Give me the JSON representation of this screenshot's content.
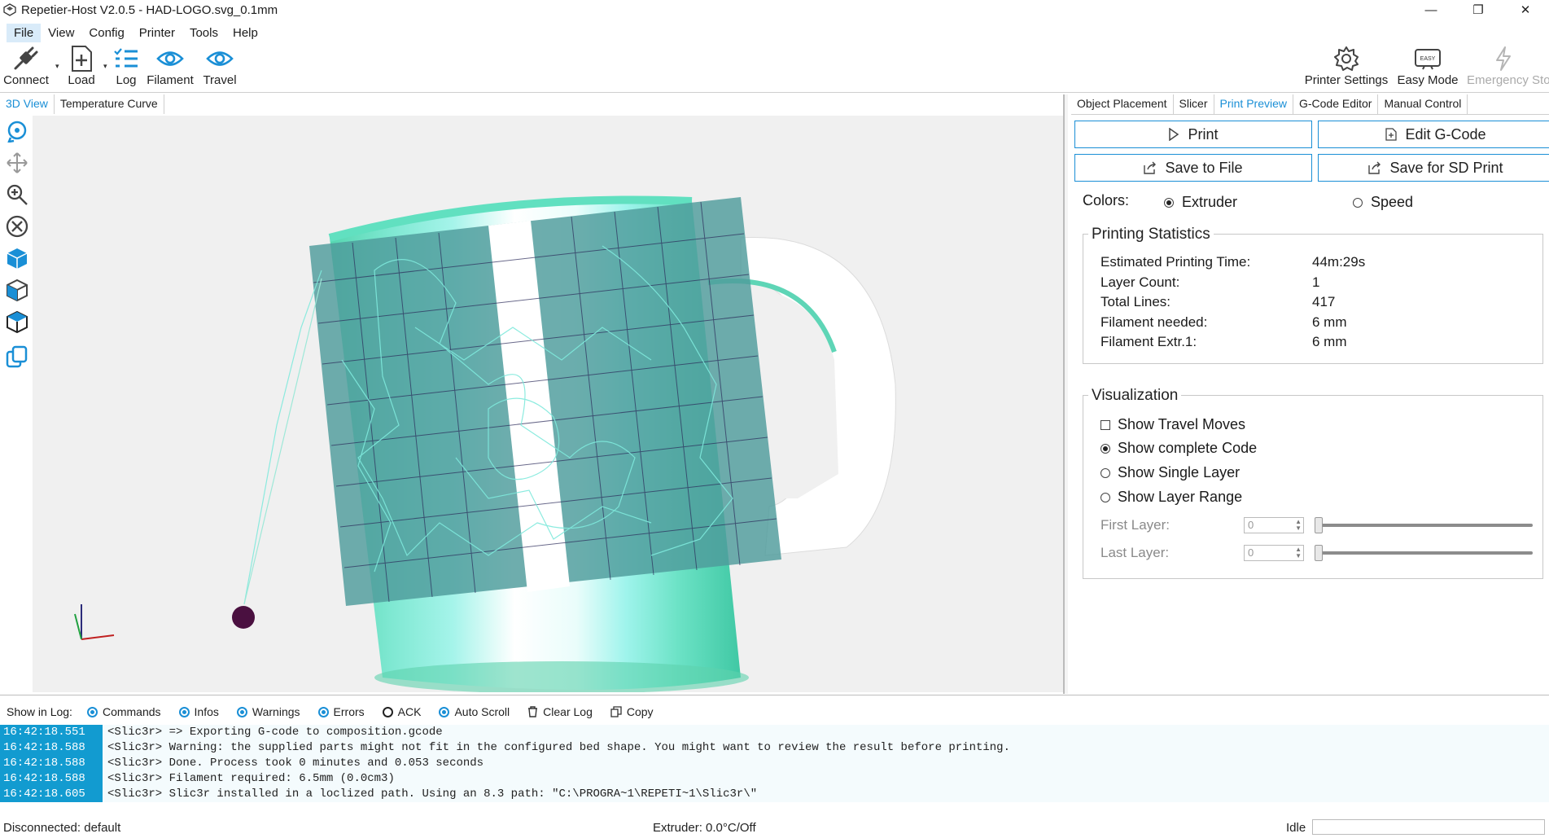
{
  "window": {
    "title": "Repetier-Host V2.0.5 - HAD-LOGO.svg_0.1mm",
    "minimize": "—",
    "maximize": "❐",
    "close": "✕"
  },
  "menu": [
    "File",
    "View",
    "Config",
    "Printer",
    "Tools",
    "Help"
  ],
  "toolbar": {
    "connect": "Connect",
    "load": "Load",
    "log": "Log",
    "filament": "Filament",
    "travel": "Travel",
    "printer_settings": "Printer Settings",
    "easy_mode": "Easy Mode",
    "easy_badge": "EASY",
    "emergency_stop": "Emergency Sto"
  },
  "left_tabs": [
    "3D View",
    "Temperature Curve"
  ],
  "right_tabs": [
    "Object Placement",
    "Slicer",
    "Print Preview",
    "G-Code Editor",
    "Manual Control"
  ],
  "actions": {
    "print": "Print",
    "edit_gcode": "Edit G-Code",
    "save_to_file": "Save to File",
    "save_for_sd": "Save for SD Print"
  },
  "colors": {
    "label": "Colors:",
    "extruder": "Extruder",
    "speed": "Speed",
    "accent": "#1a8fd6",
    "log_timestamp_bg": "#129bd0"
  },
  "statistics": {
    "title": "Printing Statistics",
    "rows": [
      {
        "label": "Estimated Printing Time:",
        "value": "44m:29s"
      },
      {
        "label": "Layer Count:",
        "value": "1"
      },
      {
        "label": "Total Lines:",
        "value": "417"
      },
      {
        "label": "Filament needed:",
        "value": "6 mm"
      },
      {
        "label": "Filament Extr.1:",
        "value": "6 mm"
      }
    ]
  },
  "visualization": {
    "title": "Visualization",
    "show_travel": "Show Travel Moves",
    "show_complete": "Show complete Code",
    "show_single": "Show Single Layer",
    "show_range": "Show Layer Range",
    "first_layer": "First Layer:",
    "last_layer": "Last Layer:",
    "first_value": "0",
    "last_value": "0"
  },
  "log": {
    "show_label": "Show in Log:",
    "options": [
      "Commands",
      "Infos",
      "Warnings",
      "Errors",
      "ACK",
      "Auto Scroll"
    ],
    "clear": "Clear Log",
    "copy": "Copy",
    "rows": [
      {
        "time": "16:42:18.551",
        "msg": "<Slic3r> => Exporting G-code to composition.gcode"
      },
      {
        "time": "16:42:18.588",
        "msg": "<Slic3r> Warning: the supplied parts might not fit in the configured bed shape. You might want to review the result before printing."
      },
      {
        "time": "16:42:18.588",
        "msg": "<Slic3r> Done. Process took 0 minutes and 0.053 seconds"
      },
      {
        "time": "16:42:18.588",
        "msg": "<Slic3r> Filament required: 6.5mm (0.0cm3)"
      },
      {
        "time": "16:42:18.605",
        "msg": "<Slic3r> Slic3r installed in a loclized path. Using an 8.3 path: \"C:\\PROGRA~1\\REPETI~1\\Slic3r\\\""
      }
    ]
  },
  "status": {
    "connection": "Disconnected: default",
    "extruder": "Extruder: 0.0°C/Off",
    "state": "Idle"
  }
}
